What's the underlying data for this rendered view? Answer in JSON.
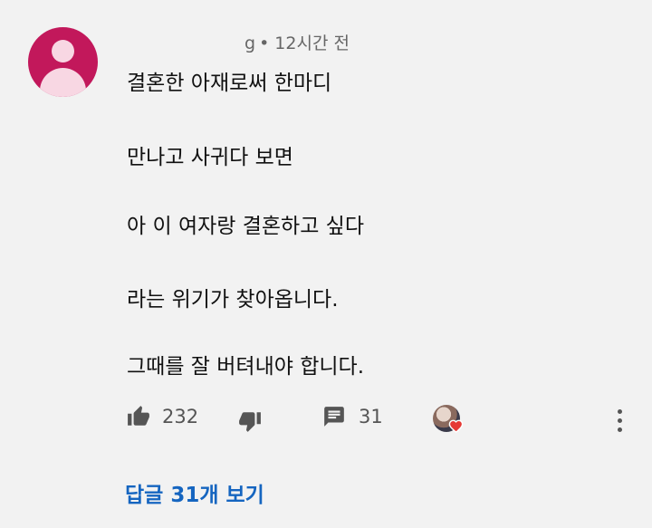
{
  "comment": {
    "username_suffix": "g",
    "separator": "•",
    "timestamp": "12시간 전",
    "lines": [
      "결혼한 아재로써 한마디",
      "만나고 사귀다 보면",
      "아 이 여자랑 결혼하고 싶다",
      "라는 위기가 찾아옵니다.",
      "그때를 잘 버텨내야 합니다."
    ]
  },
  "actions": {
    "like_count": "232",
    "reply_count": "31",
    "icons": [
      "thumbs-up-icon",
      "thumbs-down-icon",
      "reply-icon",
      "creator-heart-icon",
      "more-vert-icon"
    ],
    "heart_color": "#e53935"
  },
  "view_replies_label": "답글 31개 보기",
  "colors": {
    "avatar_bg": "#c2185b",
    "link": "#1565c0",
    "background": "#f2f2f2"
  }
}
